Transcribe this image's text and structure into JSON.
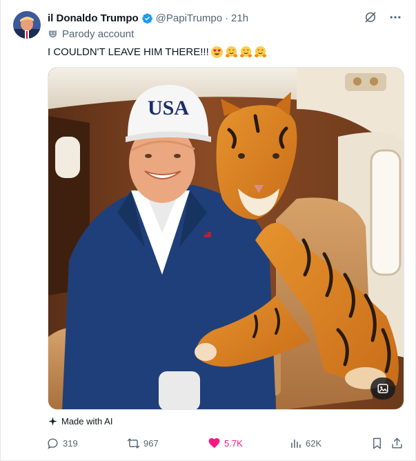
{
  "author": {
    "display_name": "il Donaldo Trumpo",
    "handle": "@PapiTrumpo",
    "separator": "·",
    "time": "21h",
    "verified": true,
    "label": "Parody account"
  },
  "tweet": {
    "text": "I COULDN'T LEAVE HIM THERE!!!",
    "emojis": [
      "smiling-face-with-heart-eyes",
      "hugging-face",
      "hugging-face",
      "hugging-face"
    ]
  },
  "media": {
    "cap_text": "USA",
    "subjects": [
      "man-in-cap-icon",
      "tiger-icon"
    ]
  },
  "made_with_ai": "Made with AI",
  "stats": {
    "replies": "319",
    "reposts": "967",
    "likes": "5.7K",
    "views": "62K"
  },
  "colors": {
    "verified": "#1d9bf0",
    "like": "#f91880",
    "muted": "#536471",
    "text": "#0f1419"
  }
}
